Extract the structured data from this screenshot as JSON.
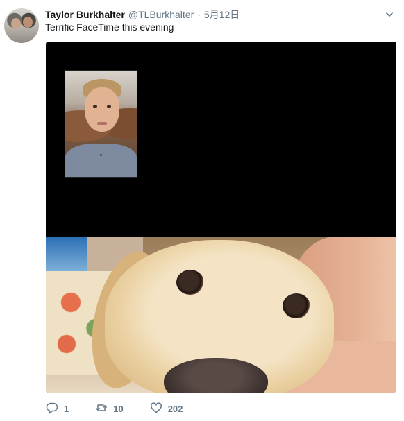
{
  "tweet": {
    "author_name": "Taylor Burkhalter",
    "handle": "@TLBurkhalter",
    "separator": "·",
    "date": "5月12日",
    "text": "Terrific FaceTime this evening"
  },
  "actions": {
    "reply_count": "1",
    "retweet_count": "10",
    "like_count": "202"
  },
  "icons": {
    "caret": "chevron-down-icon",
    "reply": "reply-icon",
    "retweet": "retweet-icon",
    "like": "heart-icon"
  },
  "colors": {
    "secondary_text": "#657786",
    "primary_text": "#14171a",
    "media_background": "#000000"
  }
}
